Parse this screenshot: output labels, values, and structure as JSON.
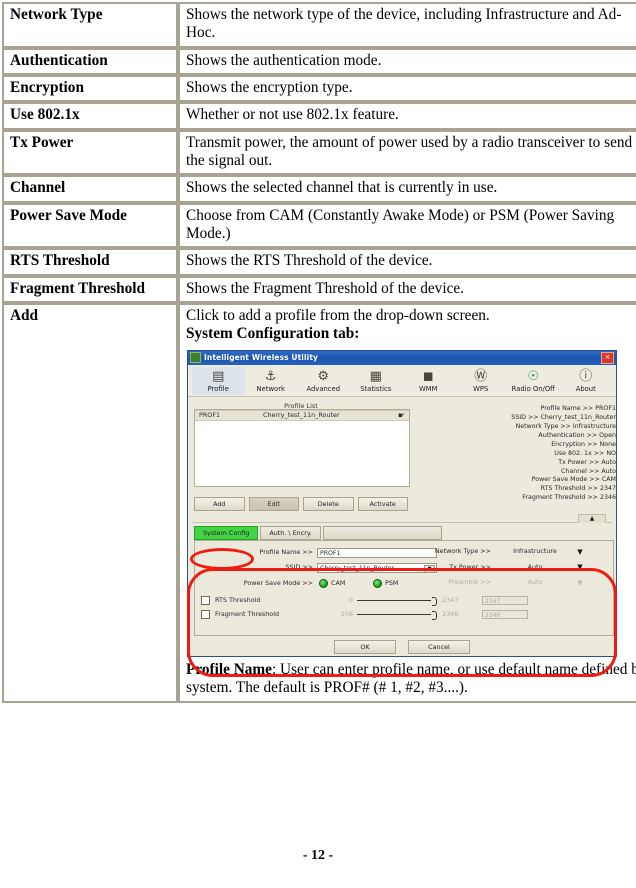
{
  "page": {
    "number_label": "- 12 -"
  },
  "table": {
    "rows": [
      {
        "term": "Network Type",
        "desc": "Shows the network type of the device, including Infrastructure and Ad-Hoc."
      },
      {
        "term": "Authentication",
        "desc": "Shows the authentication mode."
      },
      {
        "term": "Encryption",
        "desc": "Shows the encryption type."
      },
      {
        "term": "Use 802.1x",
        "desc": "Whether or not use 802.1x feature."
      },
      {
        "term": "Tx Power",
        "desc": "Transmit power, the amount of power used by a radio transceiver to send the signal out."
      },
      {
        "term": "Channel",
        "desc": "Shows the selected channel that is currently in use."
      },
      {
        "term": "Power Save Mode",
        "desc": "Choose from CAM (Constantly Awake Mode) or PSM (Power Saving Mode.)"
      },
      {
        "term": "RTS Threshold",
        "desc": "Shows the RTS Threshold of the device."
      },
      {
        "term": "Fragment Threshold",
        "desc": "Shows the Fragment Threshold of the device."
      }
    ],
    "add_row": {
      "term": "Add",
      "line1": "Click to add a profile from the drop-down screen.",
      "line2": "System Configuration tab:",
      "caption_lead": "Profile Name",
      "caption_rest": ": User can enter profile name, or use default name defined by system. The default is PROF# (# 1, #2, #3....)."
    }
  },
  "app": {
    "title": "Intelligent Wireless Utility",
    "close_label": "×",
    "toolbar": [
      {
        "label": "Profile",
        "icon": "▤"
      },
      {
        "label": "Network",
        "icon": "⚓"
      },
      {
        "label": "Advanced",
        "icon": "⚙"
      },
      {
        "label": "Statistics",
        "icon": "▦"
      },
      {
        "label": "WMM",
        "icon": "◼"
      },
      {
        "label": "WPS",
        "icon": "Ⓦ"
      },
      {
        "label": "Radio On/Off",
        "icon": "☉"
      },
      {
        "label": "About",
        "icon": "ⓘ"
      }
    ],
    "profile_list": {
      "legend": "Profile List",
      "row": {
        "name": "PROF1",
        "ssid": "Cherry_test_11n_Router",
        "status_icon": "☛"
      }
    },
    "details": [
      "Profile Name >> PROF1",
      "SSID >> Cherry_test_11n_Router",
      "Network Type >> Infrastructure",
      "Authentication >> Open",
      "Encryption >> None",
      "Use 802. 1x >> NO",
      "Tx Power >> Auto",
      "Channel >> Auto",
      "Power Save Mode >> CAM",
      "RTS Threshold >> 2347",
      "Fragment Threshold >> 2346"
    ],
    "buttons": [
      {
        "label": "Add"
      },
      {
        "label": "Edit"
      },
      {
        "label": "Delete"
      },
      {
        "label": "Activate"
      }
    ],
    "collapse_icon": "▲",
    "subtabs": [
      {
        "label": "System Config",
        "highlighted": true
      },
      {
        "label": "Auth. \\ Encry.",
        "highlighted": false
      }
    ],
    "form": {
      "profile_name_label": "Profile Name >>",
      "profile_name_value": "PROF1",
      "ssid_label": "SSID >>",
      "ssid_value": "Cherry_test_11n_Router",
      "network_type_label": "Network Type >>",
      "network_type_value": "Infrastructure",
      "tx_power_label": "Tx Power >>",
      "tx_power_value": "Auto",
      "preamble_label": "Preamble >>",
      "preamble_value": "Auto",
      "power_save_label": "Power Save Mode >>",
      "cam_label": "CAM",
      "psm_label": "PSM",
      "rts_label": "RTS Threshold",
      "rts_min": "0",
      "rts_max": "2347",
      "rts_value": "2347",
      "frag_label": "Fragment Threshold",
      "frag_min": "256",
      "frag_max": "2346",
      "frag_value": "2346",
      "ok_label": "OK",
      "cancel_label": "Cancel",
      "dropdown_arrow": "▼"
    }
  },
  "colors": {
    "table_border": "#a9a394",
    "annotation_red": "#ee1c11",
    "tab_highlight_green": "#45d445",
    "titlebar_blue": "#1c53ad"
  }
}
